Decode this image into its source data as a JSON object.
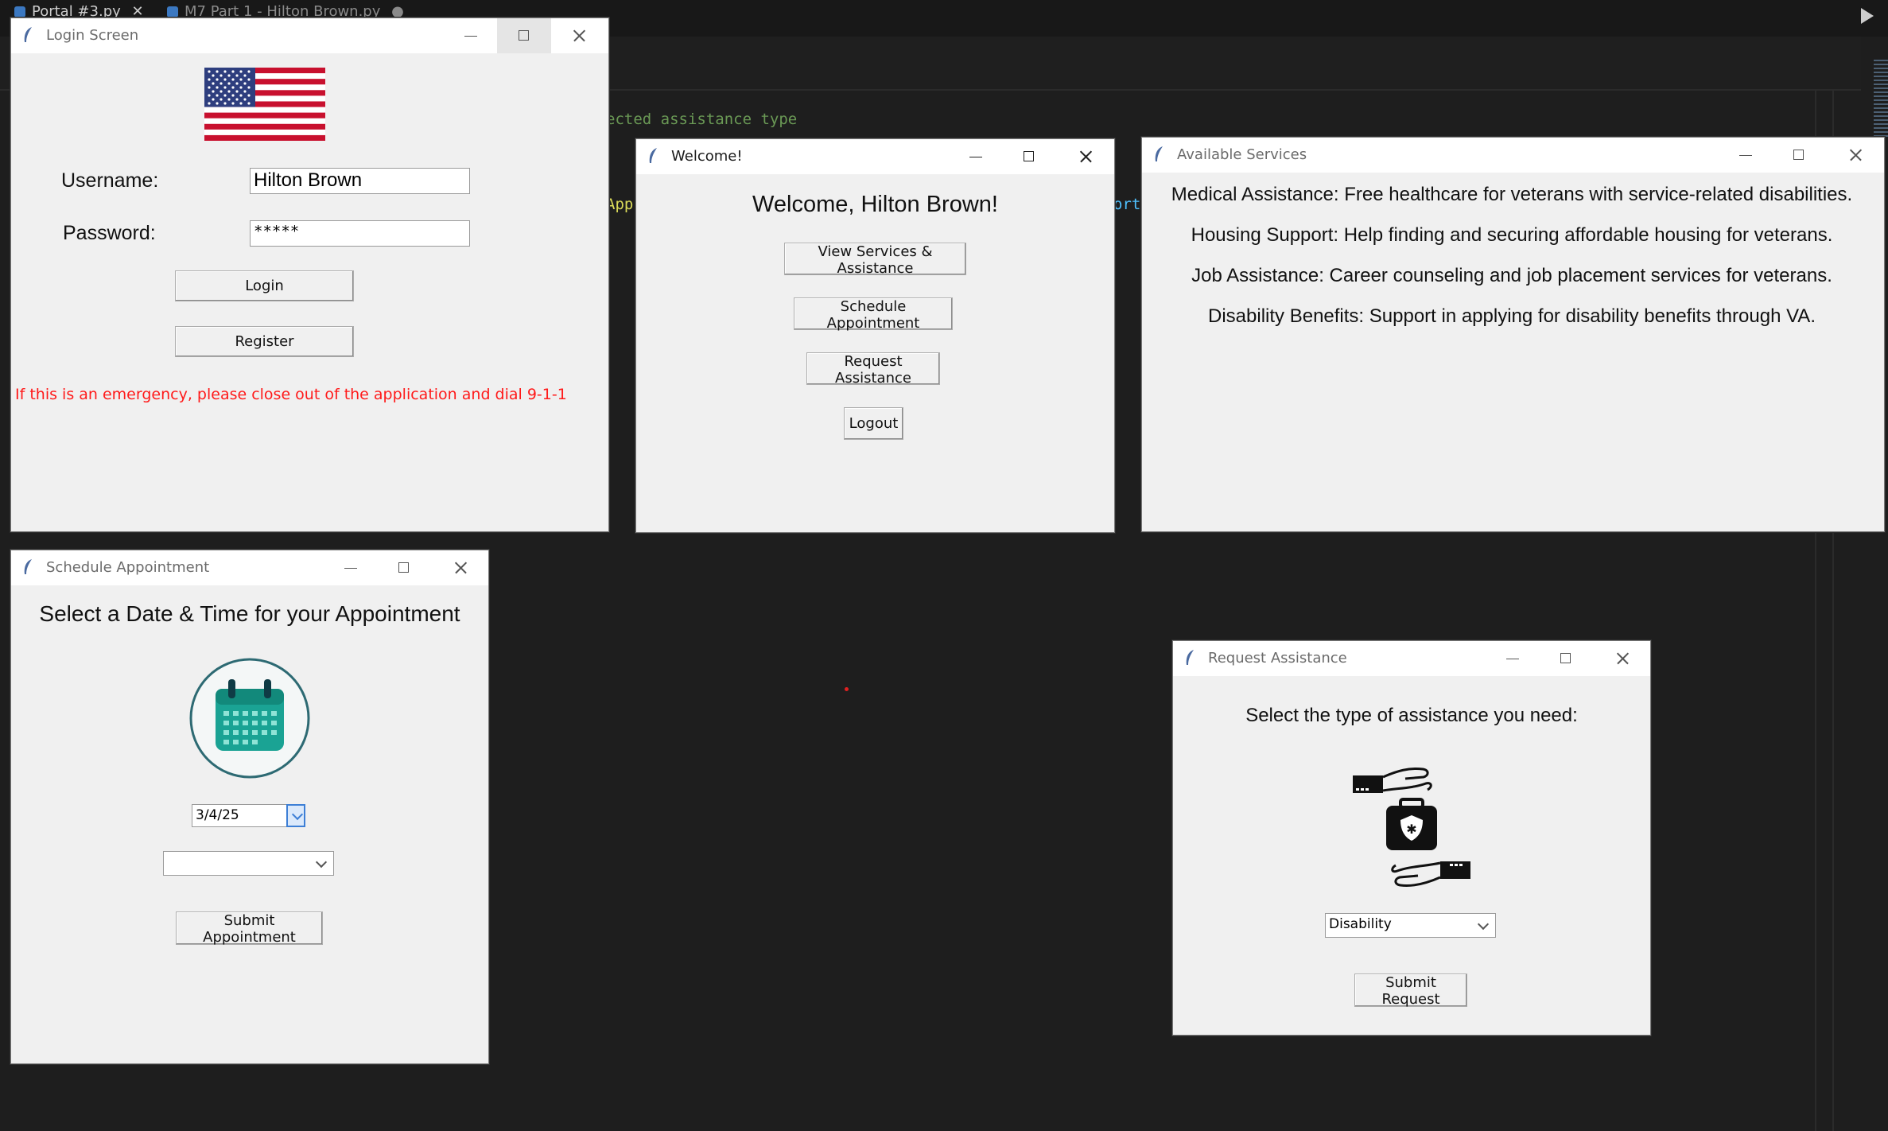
{
  "editor": {
    "tabs": [
      {
        "label": "Portal #3.py"
      },
      {
        "label": "M7 Part 1 - Hilton Brown.py"
      }
    ],
    "code_fragments": {
      "comment": "ected assistance type",
      "app": "App",
      "ort": "ort"
    }
  },
  "login_window": {
    "title": "Login Screen",
    "username_label": "Username:",
    "username_value": "Hilton Brown",
    "password_label": "Password:",
    "password_value": "*****",
    "login_button": "Login",
    "register_button": "Register",
    "emergency_notice": "If this is an emergency, please close out of the application and dial 9-1-1",
    "notice_color": "#ff1a1a"
  },
  "welcome_window": {
    "title": "Welcome!",
    "heading": "Welcome, Hilton Brown!",
    "buttons": {
      "view_services": "View Services & Assistance",
      "schedule": "Schedule Appointment",
      "request": "Request Assistance",
      "logout": "Logout"
    }
  },
  "services_window": {
    "title": "Available Services",
    "services": [
      "Medical Assistance: Free healthcare for veterans with service-related disabilities.",
      "Housing Support: Help finding and securing affordable housing for veterans.",
      "Job Assistance: Career counseling and job placement services for veterans.",
      "Disability Benefits: Support in applying for disability benefits through VA."
    ]
  },
  "schedule_window": {
    "title": "Schedule Appointment",
    "heading": "Select a Date & Time for your Appointment",
    "date_value": "3/4/25",
    "time_value": "",
    "submit_button": "Submit Appointment",
    "calendar_color": "#1aa394"
  },
  "request_window": {
    "title": "Request Assistance",
    "heading": "Select the type of assistance you need:",
    "assistance_type": "Disability",
    "submit_button": "Submit Request"
  }
}
